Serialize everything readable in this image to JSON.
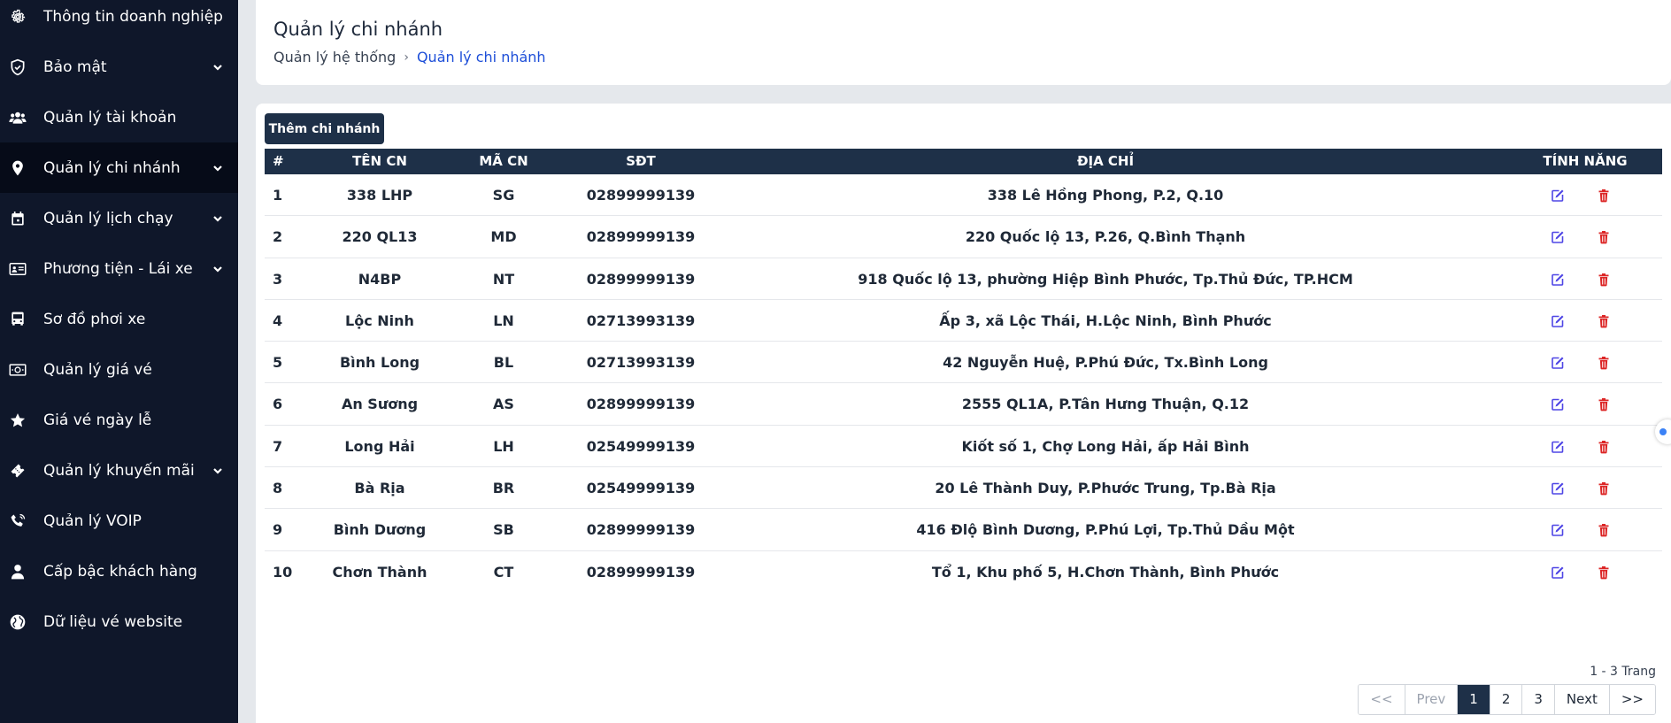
{
  "sidebar": {
    "items": [
      {
        "label": "Thông tin doanh nghiệp",
        "icon": "gear-icon",
        "has_submenu": false
      },
      {
        "label": "Bảo mật",
        "icon": "shield-icon",
        "has_submenu": true
      },
      {
        "label": "Quản lý tài khoản",
        "icon": "users-icon",
        "has_submenu": false
      },
      {
        "label": "Quản lý chi nhánh",
        "icon": "map-pin-icon",
        "has_submenu": true,
        "active": true
      },
      {
        "label": "Quản lý lịch chạy",
        "icon": "calendar-icon",
        "has_submenu": true
      },
      {
        "label": "Phương tiện - Lái xe",
        "icon": "id-card-icon",
        "has_submenu": true
      },
      {
        "label": "Sơ đồ phơi xe",
        "icon": "bus-icon",
        "has_submenu": false
      },
      {
        "label": "Quản lý giá vé",
        "icon": "money-icon",
        "has_submenu": false
      },
      {
        "label": "Giá vé ngày lễ",
        "icon": "star-icon",
        "has_submenu": false
      },
      {
        "label": "Quản lý khuyến mãi",
        "icon": "ticket-icon",
        "has_submenu": true
      },
      {
        "label": "Quản lý VOIP",
        "icon": "phone-icon",
        "has_submenu": false
      },
      {
        "label": "Cấp bậc khách hàng",
        "icon": "user-icon",
        "has_submenu": false
      },
      {
        "label": "Dữ liệu vé website",
        "icon": "globe-icon",
        "has_submenu": false
      }
    ]
  },
  "header": {
    "title": "Quản lý chi nhánh",
    "breadcrumb_parent": "Quản lý hệ thống",
    "breadcrumb_current": "Quản lý chi nhánh"
  },
  "main": {
    "add_button": "Thêm chi nhánh",
    "columns": {
      "index": "#",
      "name": "TÊN CN",
      "code": "MÃ CN",
      "phone": "SĐT",
      "address": "ĐỊA CHỈ",
      "actions": "TÍNH NĂNG"
    },
    "rows": [
      {
        "index": "1",
        "name": "338 LHP",
        "code": "SG",
        "phone": "02899999139",
        "address": "338 Lê Hồng Phong, P.2, Q.10"
      },
      {
        "index": "2",
        "name": "220 QL13",
        "code": "MD",
        "phone": "02899999139",
        "address": "220 Quốc lộ 13, P.26, Q.Bình Thạnh"
      },
      {
        "index": "3",
        "name": "N4BP",
        "code": "NT",
        "phone": "02899999139",
        "address": "918 Quốc lộ 13, phường Hiệp Bình Phước, Tp.Thủ Đức, TP.HCM"
      },
      {
        "index": "4",
        "name": "Lộc Ninh",
        "code": "LN",
        "phone": "02713993139",
        "address": "Ấp 3, xã Lộc Thái, H.Lộc Ninh, Bình Phước"
      },
      {
        "index": "5",
        "name": "Bình Long",
        "code": "BL",
        "phone": "02713993139",
        "address": "42 Nguyễn Huệ, P.Phú Đức, Tx.Bình Long"
      },
      {
        "index": "6",
        "name": "An Sương",
        "code": "AS",
        "phone": "02899999139",
        "address": "2555 QL1A, P.Tân Hưng Thuận, Q.12"
      },
      {
        "index": "7",
        "name": "Long Hải",
        "code": "LH",
        "phone": "02549999139",
        "address": "Kiốt số 1, Chợ Long Hải, ấp Hải Bình"
      },
      {
        "index": "8",
        "name": "Bà Rịa",
        "code": "BR",
        "phone": "02549999139",
        "address": "20 Lê Thành Duy, P.Phước Trung, Tp.Bà Rịa"
      },
      {
        "index": "9",
        "name": "Bình Dương",
        "code": "SB",
        "phone": "02899999139",
        "address": "416 Đlộ Bình Dương, P.Phú Lợi, Tp.Thủ Dầu Một"
      },
      {
        "index": "10",
        "name": "Chơn Thành",
        "code": "CT",
        "phone": "02899999139",
        "address": "Tổ 1, Khu phố 5, H.Chơn Thành, Bình Phước"
      }
    ]
  },
  "pagination": {
    "info": "1 - 3 Trang",
    "first": "<<",
    "prev": "Prev",
    "pages": [
      "1",
      "2",
      "3"
    ],
    "current": "1",
    "next": "Next",
    "last": ">>"
  },
  "colors": {
    "sidebar_bg": "#0f172a",
    "header_bg": "#1e3048",
    "accent_link": "#1d4ed8",
    "edit_icon": "#4f46e5",
    "delete_icon": "#dc2626"
  }
}
